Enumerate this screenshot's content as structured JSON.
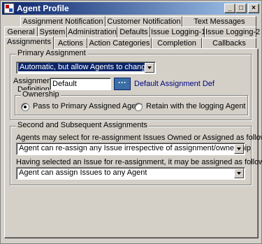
{
  "window": {
    "title": "Agent Profile",
    "minimize": "_",
    "maximize": "□",
    "close": "×"
  },
  "tabs_row1": [
    "Assignment Notification",
    "Customer Notification",
    "Text Messages"
  ],
  "tabs_row2": [
    "General",
    "System",
    "Administration",
    "Defaults",
    "Issue Logging-1",
    "Issue Logging-2"
  ],
  "tabs_row3": [
    "Assignments",
    "Actions",
    "Action Categories",
    "Completion",
    "Callbacks"
  ],
  "active_tab": "Assignments",
  "primary": {
    "group_label": "Primary Assignment",
    "mode_value": "Automatic, but allow Agents to change",
    "definition_label_1": "Assignment",
    "definition_label_2": "Definition:",
    "definition_value": "Default",
    "browse_label": "···",
    "definition_description": "Default Assignment Def",
    "ownership_label": "Ownership",
    "radio_pass_label": "Pass to Primary Assigned Agent",
    "radio_retain_label": "Retain with the logging Agent",
    "selected_radio": "pass"
  },
  "secondary": {
    "group_label": "Second and Subsequent Assignments",
    "reassign_label": "Agents may select for re-assignment Issues Owned or Assigned as follows:",
    "reassign_value": "Agent can re-assign any Issue irrespective of assignment/ownership",
    "assign_label": "Having selected an Issue for re-assignment, it may be assigned as follows:",
    "assign_value": "Agent can assign Issues to any Agent"
  }
}
